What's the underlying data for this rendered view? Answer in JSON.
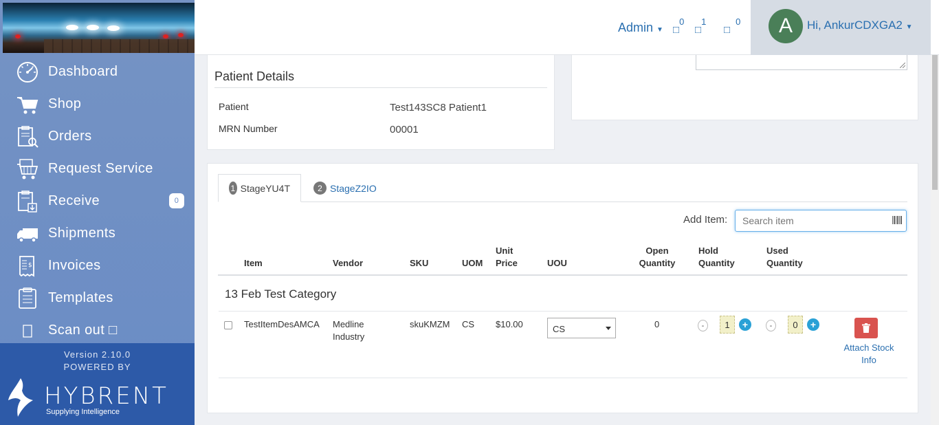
{
  "sidebar": {
    "items": [
      {
        "label": "Dashboard",
        "icon": "dashboard-icon"
      },
      {
        "label": "Shop",
        "icon": "cart-icon"
      },
      {
        "label": "Orders",
        "icon": "orders-icon"
      },
      {
        "label": "Request Service",
        "icon": "request-service-icon"
      },
      {
        "label": "Receive",
        "icon": "receive-icon",
        "badge": "0"
      },
      {
        "label": "Shipments",
        "icon": "truck-icon"
      },
      {
        "label": "Invoices",
        "icon": "invoice-icon"
      },
      {
        "label": "Templates",
        "icon": "templates-icon"
      },
      {
        "label": "Scan out □",
        "icon": "scan-out-icon"
      }
    ],
    "version": "Version 2.10.0",
    "powered_by": "POWERED BY",
    "brand": "HYBRENT",
    "brand_tagline": "Supplying Intelligence"
  },
  "header": {
    "admin_label": "Admin",
    "notif_1_count": "0",
    "notif_2_count": "1",
    "notif_3_count": "0",
    "notif_glyph": "□",
    "avatar_letter": "A",
    "user_greeting": "Hi, AnkurCDXGA2"
  },
  "patient_details": {
    "title": "Patient Details",
    "patient_label": "Patient",
    "patient_value": "Test143SC8 Patient1",
    "mrn_label": "MRN Number",
    "mrn_value": "00001"
  },
  "tabs": [
    {
      "num": "1",
      "label": "StageYU4T",
      "active": true
    },
    {
      "num": "2",
      "label": "StageZ2IO",
      "active": false
    }
  ],
  "add_item": {
    "label": "Add Item:",
    "placeholder": "Search item"
  },
  "table": {
    "headers": {
      "item": "Item",
      "vendor": "Vendor",
      "sku": "SKU",
      "uom": "UOM",
      "unit_price_1": "Unit",
      "unit_price_2": "Price",
      "uou": "UOU",
      "open_qty_1": "Open",
      "open_qty_2": "Quantity",
      "hold_qty_1": "Hold",
      "hold_qty_2": "Quantity",
      "used_qty_1": "Used",
      "used_qty_2": "Quantity"
    },
    "category": "13 Feb Test Category",
    "rows": [
      {
        "item": "TestItemDesAMCA",
        "vendor_1": "Medline",
        "vendor_2": "Industry",
        "sku": "skuKMZM",
        "uom": "CS",
        "unit_price": "$10.00",
        "uou": "CS",
        "open_quantity": "0",
        "hold_quantity": "1",
        "used_quantity": "0",
        "attach_1": "Attach Stock",
        "attach_2": "Info"
      }
    ]
  },
  "colors": {
    "sidebar": "#6a8cc5",
    "sidebar_footer": "#2d5aa8",
    "link": "#2a6fb0",
    "delete": "#d9534f",
    "plus": "#2aa1d6",
    "avatar": "#4a7f58"
  }
}
